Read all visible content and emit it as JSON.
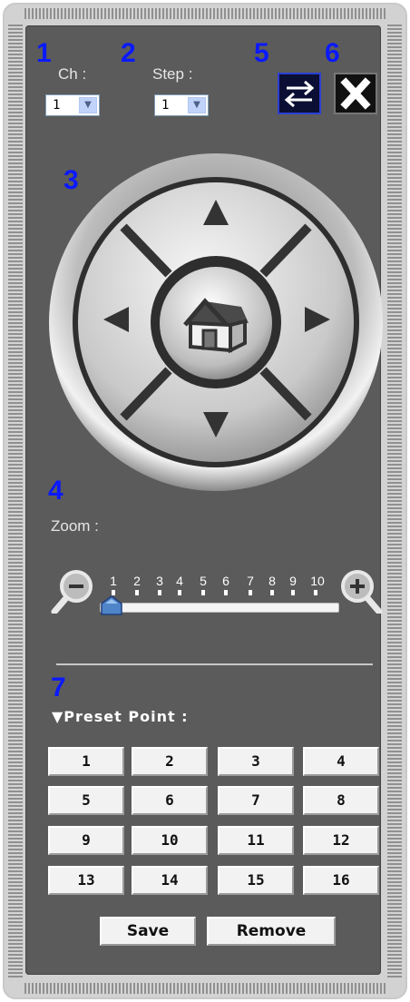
{
  "annotations": [
    "1",
    "2",
    "3",
    "4",
    "5",
    "6",
    "7"
  ],
  "channel": {
    "label": "Ch :",
    "value": "1"
  },
  "step": {
    "label": "Step :",
    "value": "1"
  },
  "zoom": {
    "label": "Zoom :",
    "ticks": [
      "1",
      "2",
      "3",
      "4",
      "5",
      "6",
      "7",
      "8",
      "9",
      "10"
    ],
    "level": 1
  },
  "preset": {
    "title": "▼Preset Point :",
    "points": [
      "1",
      "2",
      "3",
      "4",
      "5",
      "6",
      "7",
      "8",
      "9",
      "10",
      "11",
      "12",
      "13",
      "14",
      "15",
      "16"
    ],
    "save_label": "Save",
    "remove_label": "Remove"
  },
  "icons": {
    "swap": "swap-arrows-icon",
    "close": "close-icon",
    "home": "home-icon",
    "up": "up-arrow-icon",
    "down": "down-arrow-icon",
    "left": "left-arrow-icon",
    "right": "right-arrow-icon",
    "zoom_out": "zoom-out-icon",
    "zoom_in": "zoom-in-icon"
  },
  "colors": {
    "annotation": "#0a19ff",
    "panel": "#5b5b5b",
    "accent": "#0d2c8a"
  }
}
